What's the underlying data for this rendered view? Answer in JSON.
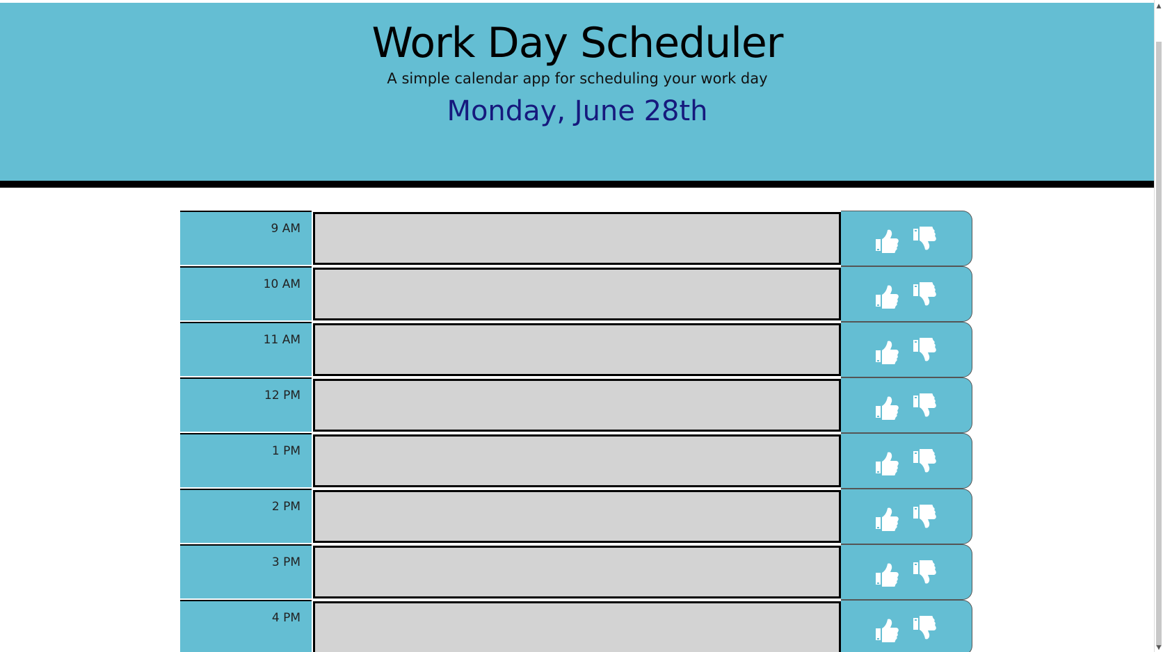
{
  "header": {
    "title": "Work Day Scheduler",
    "subtitle": "A simple calendar app for scheduling your work day",
    "current_day": "Monday, June 28th"
  },
  "colors": {
    "header_background": "#64bed3",
    "header_border": "#000000",
    "date_text": "#16197d",
    "textarea_background": "#d3d3d3",
    "row_accent": "#64bed3",
    "icon": "#ffffff"
  },
  "timeblocks": [
    {
      "hour": "9 AM",
      "description": "",
      "save_icon": "thumbs-up-icon",
      "clear_icon": "thumbs-down-icon"
    },
    {
      "hour": "10 AM",
      "description": "",
      "save_icon": "thumbs-up-icon",
      "clear_icon": "thumbs-down-icon"
    },
    {
      "hour": "11 AM",
      "description": "",
      "save_icon": "thumbs-up-icon",
      "clear_icon": "thumbs-down-icon"
    },
    {
      "hour": "12 PM",
      "description": "",
      "save_icon": "thumbs-up-icon",
      "clear_icon": "thumbs-down-icon"
    },
    {
      "hour": "1 PM",
      "description": "",
      "save_icon": "thumbs-up-icon",
      "clear_icon": "thumbs-down-icon"
    },
    {
      "hour": "2 PM",
      "description": "",
      "save_icon": "thumbs-up-icon",
      "clear_icon": "thumbs-down-icon"
    },
    {
      "hour": "3 PM",
      "description": "",
      "save_icon": "thumbs-up-icon",
      "clear_icon": "thumbs-down-icon"
    },
    {
      "hour": "4 PM",
      "description": "",
      "save_icon": "thumbs-up-icon",
      "clear_icon": "thumbs-down-icon"
    }
  ]
}
